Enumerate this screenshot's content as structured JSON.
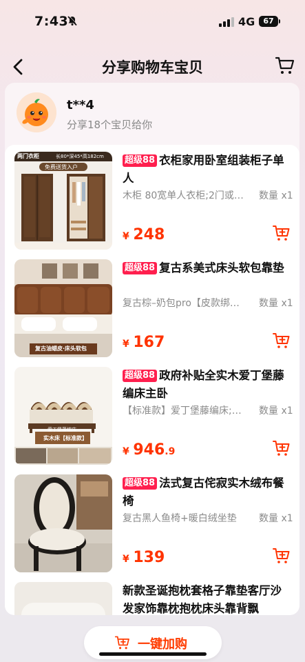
{
  "status": {
    "time": "7:43",
    "network": "4G",
    "battery": "67"
  },
  "nav": {
    "title": "分享购物车宝贝"
  },
  "sharer": {
    "name": "t**4",
    "subtitle": "分享18个宝贝给你"
  },
  "items": [
    {
      "tag": "超级88",
      "title": "衣柜家用卧室组装柜子单人",
      "spec": "木柜 80宽单人衣柜;2门或…",
      "qty": "数量 x1",
      "price_symbol": "¥",
      "price": "248",
      "price_decimal": "",
      "thumb_caption": "两门衣柜",
      "thumb_caption2": "长80*深45*高182cm",
      "thumb_badge": "免费送货入户"
    },
    {
      "tag": "超级88",
      "title": "复古系美式床头软包靠垫",
      "spec": "复古棕–奶包pro【皮款绑…",
      "qty": "数量 x1",
      "price_symbol": "¥",
      "price": "167",
      "price_decimal": "",
      "thumb_caption": "复古油蜡皮·床头软包"
    },
    {
      "tag": "超级88",
      "title": "政府补贴全实木爱丁堡藤编床主卧",
      "spec": "【标准款】爱丁堡藤编床;1…",
      "qty": "数量 x1",
      "price_symbol": "¥",
      "price": "946",
      "price_decimal": ".9",
      "thumb_caption": "爱丁堡藤编床",
      "thumb_caption2": "实木床【标准款】"
    },
    {
      "tag": "超级88",
      "title": "法式复古侘寂实木绒布餐椅",
      "spec": "复古黑人鱼椅+暖白绒坐垫",
      "qty": "数量 x1",
      "price_symbol": "¥",
      "price": "139",
      "price_decimal": ""
    },
    {
      "tag": "",
      "title": "新款圣诞抱枕套格子靠垫客厅沙发家饰靠枕抱枕床头靠背飘",
      "spec": "",
      "qty": "",
      "price_symbol": "",
      "price": "",
      "price_decimal": ""
    }
  ],
  "bottom": {
    "buy_label": "一键加购"
  },
  "colors": {
    "accent": "#ff3300",
    "tag": "#ff1f4e"
  }
}
